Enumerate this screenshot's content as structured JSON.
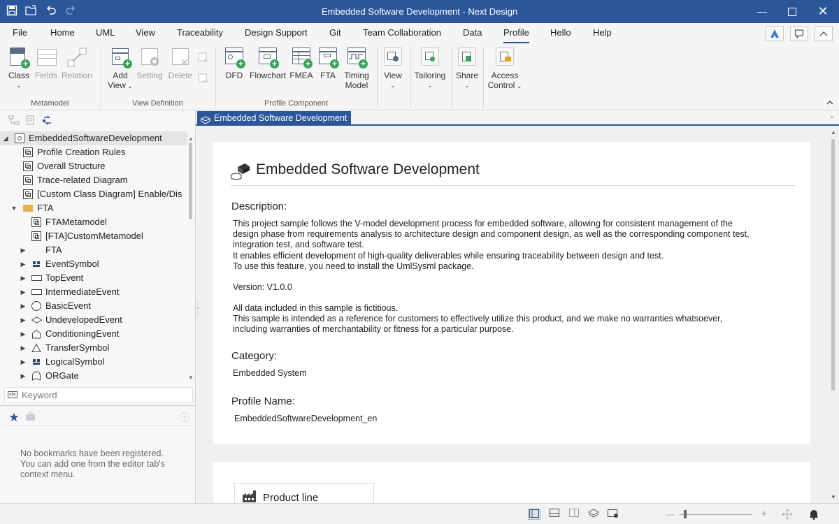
{
  "app": {
    "title": "Embedded Software Development - Next Design"
  },
  "menu": {
    "items": [
      "File",
      "Home",
      "UML",
      "View",
      "Traceability",
      "Design Support",
      "Git",
      "Team Collaboration",
      "Data",
      "Profile",
      "Hello",
      "Help"
    ],
    "active": "Profile"
  },
  "ribbon": {
    "metamodel": {
      "group": "Metamodel",
      "class": "Class",
      "fields": "Fields",
      "relation": "Relation"
    },
    "view_definition": {
      "group": "View Definition",
      "add_view_1": "Add",
      "add_view_2": "View",
      "setting": "Setting",
      "delete": "Delete"
    },
    "profile_component": {
      "group": "Profile Component",
      "dfd": "DFD",
      "flowchart": "Flowchart",
      "fmea": "FMEA",
      "fta": "FTA",
      "timing_1": "Timing",
      "timing_2": "Model"
    },
    "view": "View",
    "tailoring": "Tailoring",
    "share": "Share",
    "access_1": "Access",
    "access_2": "Control"
  },
  "tree": {
    "root": "EmbeddedSoftwareDevelopment",
    "items": [
      {
        "label": "Profile Creation Rules"
      },
      {
        "label": "Overall Structure"
      },
      {
        "label": "Trace-related Diagram"
      },
      {
        "label": "[Custom Class Diagram] Enable/Dis"
      },
      {
        "label": "FTA"
      },
      {
        "label": "FTAMetamodel"
      },
      {
        "label": "[FTA]CustomMetamodel"
      },
      {
        "label": "FTA"
      },
      {
        "label": "EventSymbol"
      },
      {
        "label": "TopEvent"
      },
      {
        "label": "IntermediateEvent"
      },
      {
        "label": "BasicEvent"
      },
      {
        "label": "UndevelopedEvent"
      },
      {
        "label": "ConditioningEvent"
      },
      {
        "label": "TransferSymbol"
      },
      {
        "label": "LogicalSymbol"
      },
      {
        "label": "ORGate"
      }
    ]
  },
  "search": {
    "placeholder": "Keyword"
  },
  "bookmarks": {
    "empty_1": "No bookmarks have been registered.",
    "empty_2": "You can add one from the editor tab's",
    "empty_3": "context menu."
  },
  "tab": {
    "label": "Embedded Software Development"
  },
  "document": {
    "heading": "Embedded Software Development",
    "description_label": "Description:",
    "description_lines": [
      "This project sample follows the V-model development process for embedded software, allowing for consistent management of the",
      "design phase from requirements analysis to architecture design and component design, as well as the corresponding component test,",
      "integration test, and software test.",
      "It enables efficient development of high-quality deliverables while ensuring traceability between design and test.",
      "To use this feature, you need to install the UmlSysml package."
    ],
    "version": "Version: V1.0.0",
    "notice_lines": [
      "All data included in this sample is fictitious.",
      "This sample is intended as a reference for customers to effectively utilize this product, and we make no warranties whatsoever,",
      "including warranties of merchantability or fitness for a particular purpose."
    ],
    "category_label": "Category:",
    "category": "Embedded System",
    "profile_label": "Profile Name:",
    "profile_name": "EmbeddedSoftwareDevelopment_en",
    "product_line": "Product line"
  },
  "colors": {
    "accent": "#2b579a",
    "add_green": "#3aa35a"
  }
}
